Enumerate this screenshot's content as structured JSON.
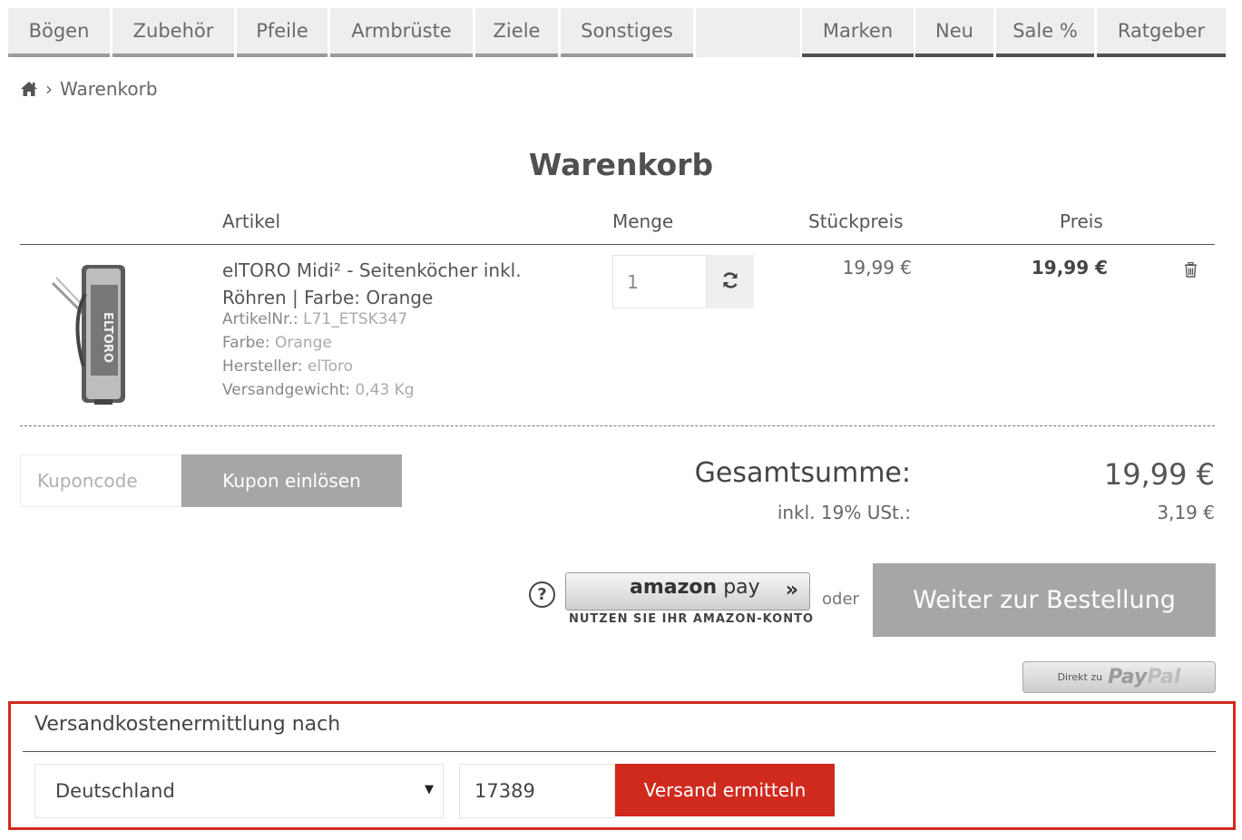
{
  "nav": {
    "items": [
      {
        "label": "Bögen"
      },
      {
        "label": "Zubehör"
      },
      {
        "label": "Pfeile"
      },
      {
        "label": "Armbrüste"
      },
      {
        "label": "Ziele"
      },
      {
        "label": "Sonstiges"
      },
      {
        "label": "Marken"
      },
      {
        "label": "Neu"
      },
      {
        "label": "Sale %"
      },
      {
        "label": "Ratgeber"
      }
    ]
  },
  "breadcrumb": {
    "home_icon": "home-icon",
    "separator": "›",
    "current": "Warenkorb"
  },
  "page_title": "Warenkorb",
  "table": {
    "headers": {
      "article": "Artikel",
      "qty": "Menge",
      "unit_price": "Stückpreis",
      "price": "Preis"
    }
  },
  "item": {
    "name": "elTORO Midi² - Seitenköcher inkl. Röhren | Farbe: Orange",
    "image_label": "ELTORO",
    "meta": [
      {
        "label": "ArtikelNr.:",
        "value": "L71_ETSK347"
      },
      {
        "label": "Farbe:",
        "value": "Orange"
      },
      {
        "label": "Hersteller:",
        "value": "elToro"
      },
      {
        "label": "Versandgewicht:",
        "value": "0,43 Kg"
      }
    ],
    "quantity": "1",
    "refresh_icon": "refresh-icon",
    "unit_price": "19,99 €",
    "price": "19,99 €",
    "delete_icon": "trash-icon"
  },
  "coupon": {
    "placeholder": "Kuponcode",
    "button": "Kupon einlösen"
  },
  "totals": {
    "label": "Gesamtsumme:",
    "value": "19,99 €",
    "tax_label": "inkl. 19% USt.:",
    "tax_value": "3,19 €"
  },
  "checkout": {
    "help_symbol": "?",
    "amazon_brand": "amazon",
    "amazon_pay": "pay",
    "amazon_sub": "NUTZEN SIE IHR AMAZON-KONTO",
    "or": "oder",
    "continue": "Weiter zur Bestellung",
    "paypal_prefix": "Direkt zu",
    "paypal_logo_1": "Pay",
    "paypal_logo_2": "Pal"
  },
  "shipping": {
    "title": "Versandkostenermittlung nach",
    "country": "Deutschland",
    "zip": "17389",
    "button": "Versand ermitteln"
  },
  "colors": {
    "accent": "#d02a1e",
    "button_gray": "#a6a6a6"
  }
}
